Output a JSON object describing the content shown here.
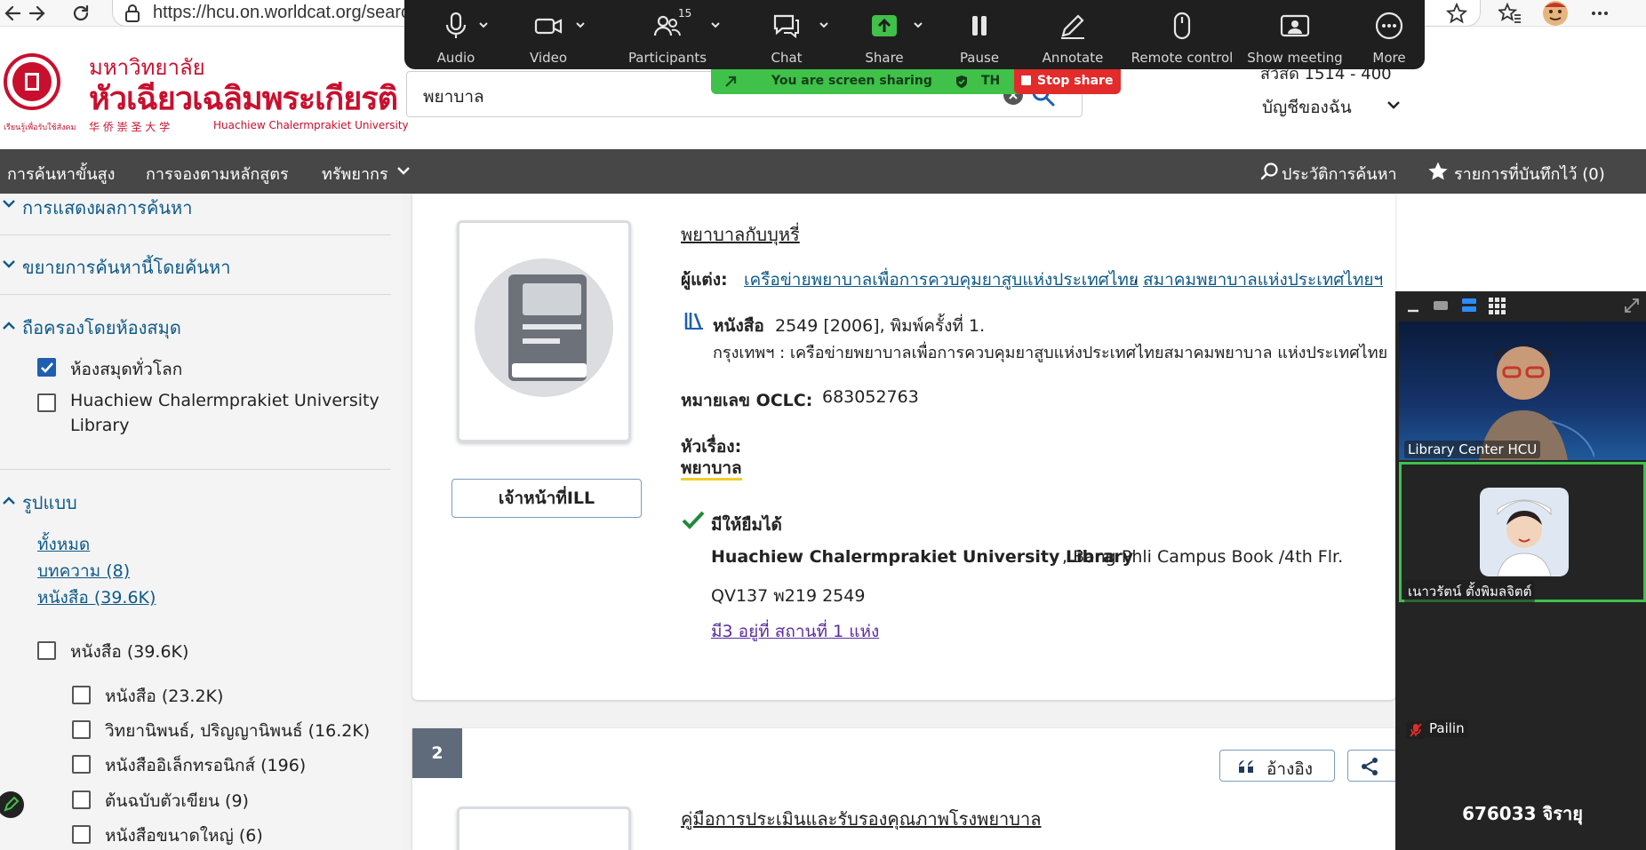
{
  "browser": {
    "url": "https://hcu.on.worldcat.org/search",
    "icons": [
      "back-arrow-icon",
      "forward-arrow-icon",
      "reload-icon",
      "site-info-icon",
      "star-icon",
      "favorites-icon",
      "profile-avatar",
      "more-icon"
    ]
  },
  "header": {
    "logo_th": "มหาวิทยาลัย",
    "logo_th_big": "หัวเฉียวเฉลิมพระเกียรติ",
    "logo_cn": "华 侨 崇 圣 大 学",
    "logo_en": "Huachiew Chalermprakiet University",
    "logo_tagline": "เรียนรู้เพื่อรับใช้สังคม",
    "search_value": "พยาบาล",
    "status_partial": "สวัสดี 1514 - 400",
    "my_account": "บัญชีของฉัน",
    "brand_color": "#c8102e"
  },
  "nav": {
    "advanced_search": "การค้นหาขั้นสูง",
    "course_reserves": "การจองตามหลักสูตร",
    "resources": "ทรัพยากร",
    "search_history": "ประวัติการค้นหา",
    "saved_items": "รายการที่บันทึกไว้ (0)"
  },
  "sidebar": {
    "display_results": "การแสดงผลการค้นหา",
    "expand_search": "ขยายการค้นหานี้โดยค้นหา",
    "held_by_library": "ถือครองโดยห้องสมุด",
    "libraries": [
      {
        "label": "ห้องสมุดทั่วโลก",
        "checked": true
      },
      {
        "label": "Huachiew Chalermprakiet University",
        "label2": "Library",
        "checked": false
      }
    ],
    "format_title": "รูปแบบ",
    "format_links": [
      "ทั้งหมด",
      "บทความ (8)",
      "หนังสือ (39.6K)"
    ],
    "format_checks": [
      {
        "label": "หนังสือ (39.6K)",
        "checked": false,
        "indent": 0
      },
      {
        "label": "หนังสือ (23.2K)",
        "checked": false,
        "indent": 1
      },
      {
        "label": "วิทยานิพนธ์, ปริญญานิพนธ์ (16.2K)",
        "checked": false,
        "indent": 1
      },
      {
        "label": "หนังสืออิเล็กทรอนิกส์ (196)",
        "checked": false,
        "indent": 1
      },
      {
        "label": "ต้นฉบับตัวเขียน (9)",
        "checked": false,
        "indent": 1
      },
      {
        "label": "หนังสือขนาดใหญ่ (6)",
        "checked": false,
        "indent": 1
      }
    ]
  },
  "result1": {
    "title": "พยาบาลกับบุหรี่",
    "author_label": "ผู้แต่ง:",
    "author1": "เครือข่ายพยาบาลเพื่อการควบคุมยาสูบแห่งประเทศไทย",
    "author_sep": ",",
    "author2": "สมาคมพยาบาลแห่งประเทศไทยฯ",
    "format_label": "หนังสือ",
    "format_detail": "2549 [2006], พิมพ์ครั้งที่ 1.",
    "publisher": "กรุงเทพฯ : เครือข่ายพยาบาลเพื่อการควบคุมยาสูบแห่งประเทศไทยสมาคมพยาบาล แห่งประเทศไทย",
    "oclc_label": "หมายเลข OCLC:",
    "oclc_value": "683052763",
    "subject_label": "หัวเรื่อง:",
    "subject_value": "พยาบาล",
    "ill_button": "เจ้าหน้าที่ILL",
    "available": "มีให้ยืมได้",
    "library_name": "Huachiew Chalermprakiet University Library",
    "library_location": ", Bang Phli Campus Book /4th Flr.",
    "call_number": "QV137 พ219 2549",
    "more_locations": "มี3 อยู่ที่ สถานที่ 1 แห่ง"
  },
  "result2": {
    "number": "2",
    "cite_button": "อ้างอิง",
    "title": "คู่มือการประเมินและรับรองคุณภาพโรงพยาบาล"
  },
  "zoom": {
    "audio": "Audio",
    "video": "Video",
    "participants": "Participants",
    "participants_count": "15",
    "chat": "Chat",
    "share": "Share",
    "pause": "Pause",
    "annotate": "Annotate",
    "remote_control": "Remote control",
    "show_meeting": "Show meeting",
    "more": "More",
    "sharing_banner": "You are screen sharing",
    "sharing_lang": "TH",
    "stop_share": "Stop share",
    "accent_green": "#3fc14a",
    "stop_red": "#e22b2b"
  },
  "gallery": {
    "tile1_name": "Library Center HCU",
    "tile2_name": "เนาวรัตน์ ตั้งพิมลจิตต์",
    "tile3_name": "Pailin",
    "tile4_name": "676033 จิรายุ"
  }
}
